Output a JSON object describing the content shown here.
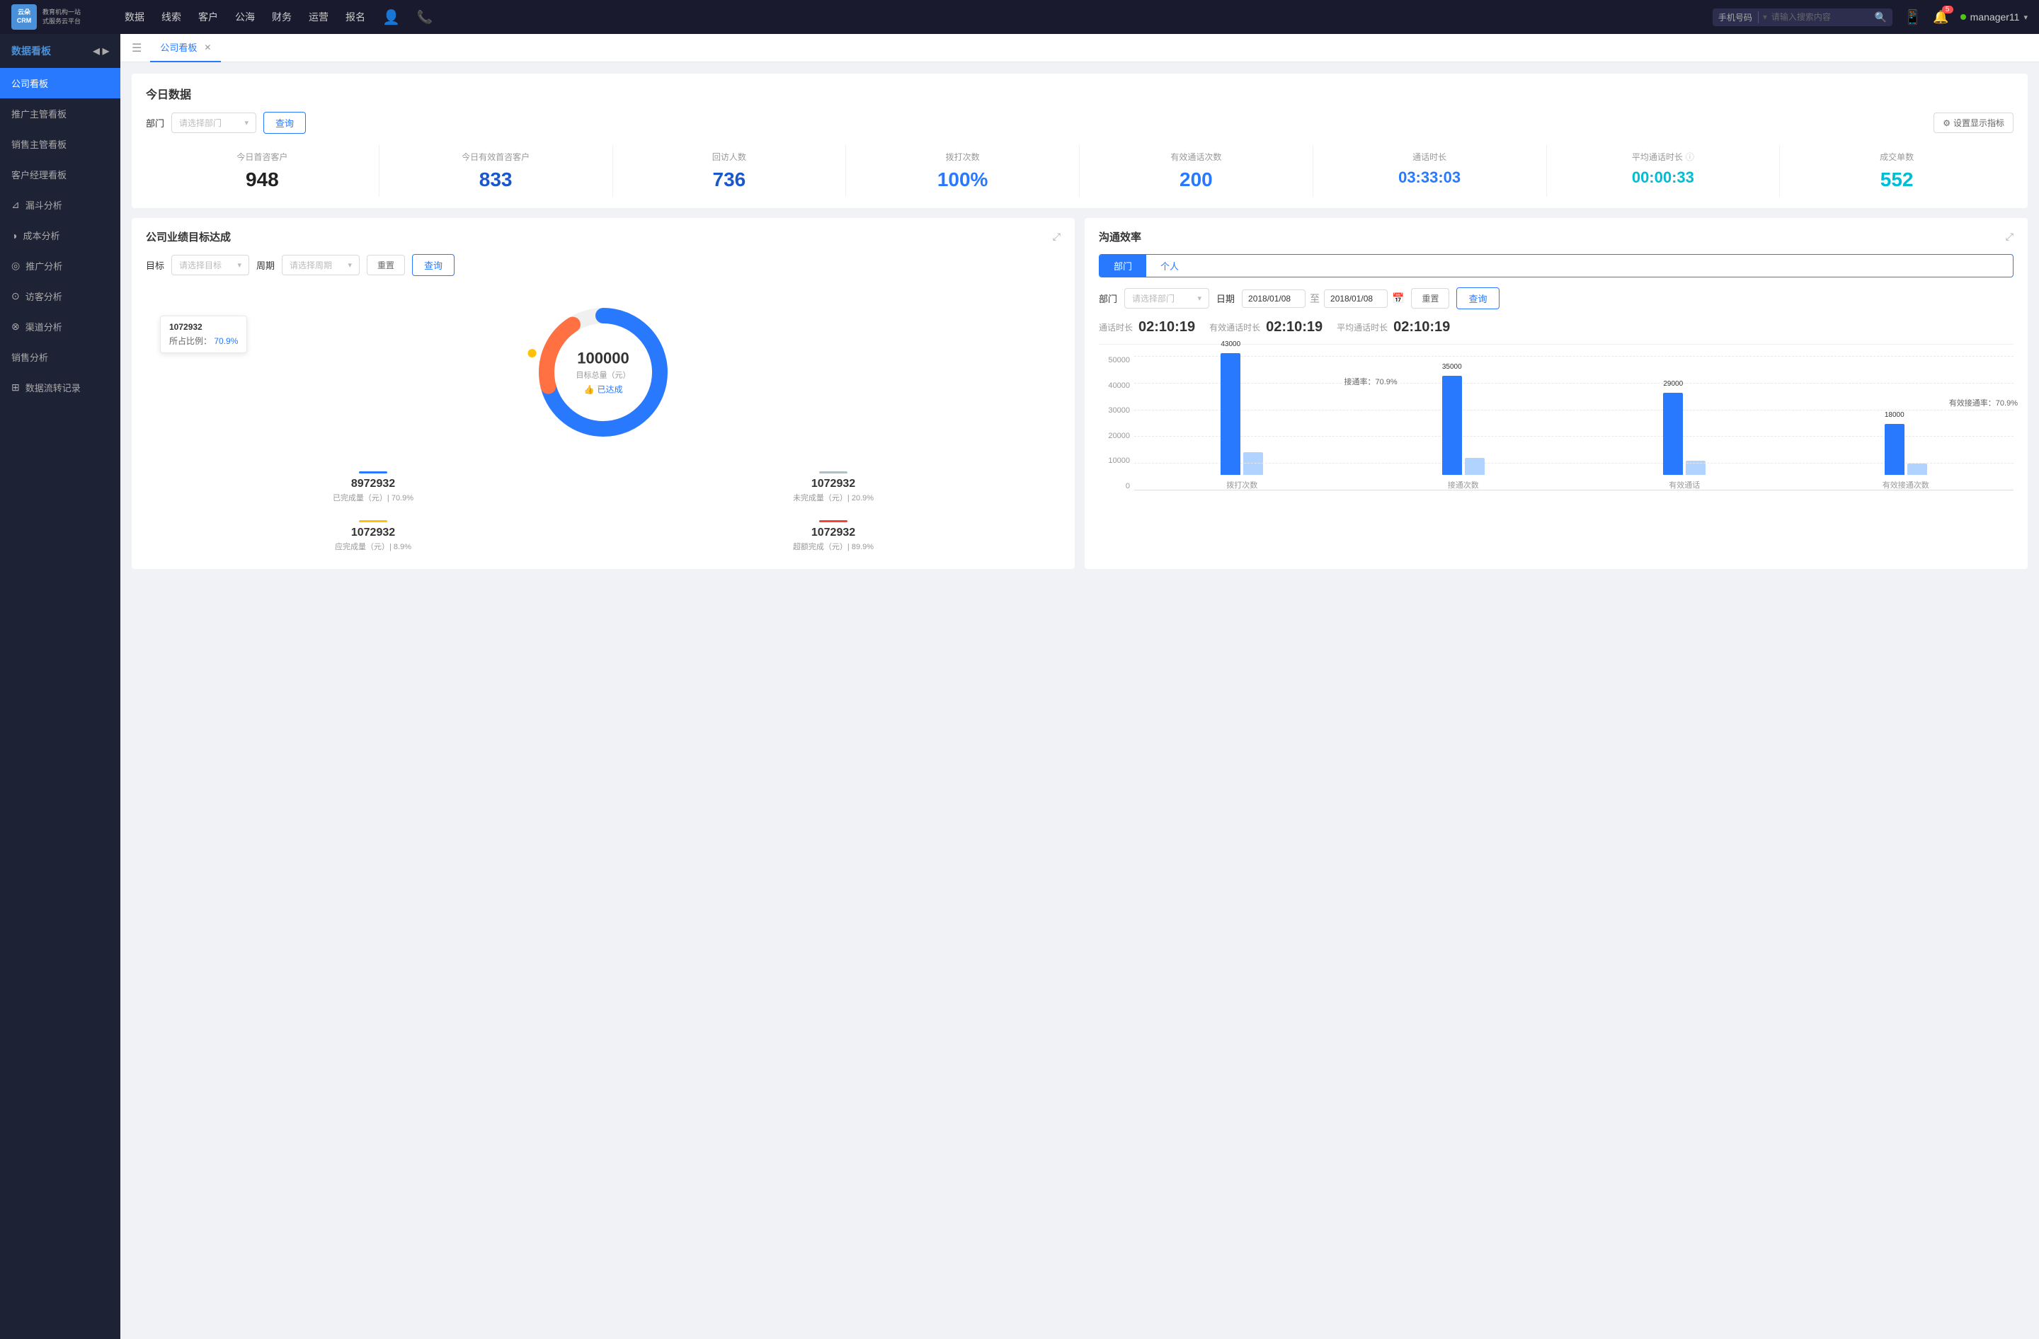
{
  "app": {
    "logo_line1": "云朵CRM",
    "logo_line2": "教育机构一站式服务云平台"
  },
  "topnav": {
    "items": [
      "数据",
      "线索",
      "客户",
      "公海",
      "财务",
      "运营",
      "报名"
    ],
    "search_type": "手机号码",
    "search_placeholder": "请输入搜索内容",
    "notification_count": "5",
    "username": "manager11"
  },
  "sidebar": {
    "header": "数据看板",
    "items": [
      {
        "label": "公司看板",
        "active": true
      },
      {
        "label": "推广主管看板",
        "active": false
      },
      {
        "label": "销售主管看板",
        "active": false
      },
      {
        "label": "客户经理看板",
        "active": false
      },
      {
        "label": "漏斗分析",
        "active": false
      },
      {
        "label": "成本分析",
        "active": false
      },
      {
        "label": "推广分析",
        "active": false
      },
      {
        "label": "访客分析",
        "active": false
      },
      {
        "label": "渠道分析",
        "active": false
      },
      {
        "label": "销售分析",
        "active": false
      },
      {
        "label": "数据流转记录",
        "active": false
      }
    ]
  },
  "tabs": [
    {
      "label": "公司看板",
      "active": true
    }
  ],
  "today": {
    "title": "今日数据",
    "filter_label": "部门",
    "select_placeholder": "请选择部门",
    "query_btn": "查询",
    "settings_btn": "设置显示指标",
    "stats": [
      {
        "label": "今日首咨客户",
        "value": "948",
        "color": "black"
      },
      {
        "label": "今日有效首咨客户",
        "value": "833",
        "color": "blue-dark"
      },
      {
        "label": "回访人数",
        "value": "736",
        "color": "blue-dark"
      },
      {
        "label": "拨打次数",
        "value": "100%",
        "color": "blue"
      },
      {
        "label": "有效通话次数",
        "value": "200",
        "color": "blue"
      },
      {
        "label": "通话时长",
        "value": "03:33:03",
        "color": "blue"
      },
      {
        "label": "平均通话时长",
        "value": "00:00:33",
        "color": "cyan"
      },
      {
        "label": "成交单数",
        "value": "552",
        "color": "cyan"
      }
    ]
  },
  "goal_card": {
    "title": "公司业绩目标达成",
    "target_label": "目标",
    "target_placeholder": "请选择目标",
    "period_label": "周期",
    "period_placeholder": "请选择周期",
    "reset_btn": "重置",
    "query_btn": "查询",
    "tooltip": {
      "value": "1072932",
      "pct_label": "所占比例：",
      "pct": "70.9%"
    },
    "donut": {
      "value": "100000",
      "label": "目标总量（元）",
      "achieved": "已达成"
    },
    "stats": [
      {
        "color": "#2979ff",
        "value": "8972932",
        "desc": "已完成量（元）| 70.9%",
        "bar_color": "#2979ff"
      },
      {
        "color": "#b0bec5",
        "value": "1072932",
        "desc": "未完成量（元）| 20.9%",
        "bar_color": "#b0bec5"
      },
      {
        "color": "#ffc107",
        "value": "1072932",
        "desc": "应完成量（元）| 8.9%",
        "bar_color": "#ffc107"
      },
      {
        "color": "#f44336",
        "value": "1072932",
        "desc": "超额完成（元）| 89.9%",
        "bar_color": "#f44336"
      }
    ]
  },
  "efficiency_card": {
    "title": "沟通效率",
    "tabs": [
      {
        "label": "部门",
        "active": true
      },
      {
        "label": "个人",
        "active": false
      }
    ],
    "dept_label": "部门",
    "dept_placeholder": "请选择部门",
    "date_label": "日期",
    "date_start": "2018/01/08",
    "date_end": "2018/01/08",
    "reset_btn": "重置",
    "query_btn": "查询",
    "stats": [
      {
        "label": "通话时长",
        "value": "02:10:19"
      },
      {
        "label": "有效通话时长",
        "value": "02:10:19"
      },
      {
        "label": "平均通话时长",
        "value": "02:10:19"
      }
    ],
    "chart": {
      "y_labels": [
        "50000",
        "40000",
        "30000",
        "20000",
        "10000",
        "0"
      ],
      "groups": [
        {
          "label": "拨打次数",
          "bars": [
            {
              "value": 43000,
              "label": "43000",
              "color": "#2979ff",
              "height": 172
            },
            {
              "value": 8000,
              "label": "",
              "color": "#b0d4ff",
              "height": 32
            }
          ]
        },
        {
          "label": "接通次数",
          "annotation": "接通率：70.9%",
          "bars": [
            {
              "value": 35000,
              "label": "35000",
              "color": "#2979ff",
              "height": 140
            },
            {
              "value": 6000,
              "label": "",
              "color": "#b0d4ff",
              "height": 24
            }
          ]
        },
        {
          "label": "有效通话",
          "bars": [
            {
              "value": 29000,
              "label": "29000",
              "color": "#2979ff",
              "height": 116
            },
            {
              "value": 5000,
              "label": "",
              "color": "#b0d4ff",
              "height": 20
            }
          ]
        },
        {
          "label": "有效接通次数",
          "annotation": "有效接通率：70.9%",
          "bars": [
            {
              "value": 18000,
              "label": "18000",
              "color": "#2979ff",
              "height": 72
            },
            {
              "value": 4000,
              "label": "",
              "color": "#b0d4ff",
              "height": 16
            }
          ]
        }
      ]
    }
  }
}
